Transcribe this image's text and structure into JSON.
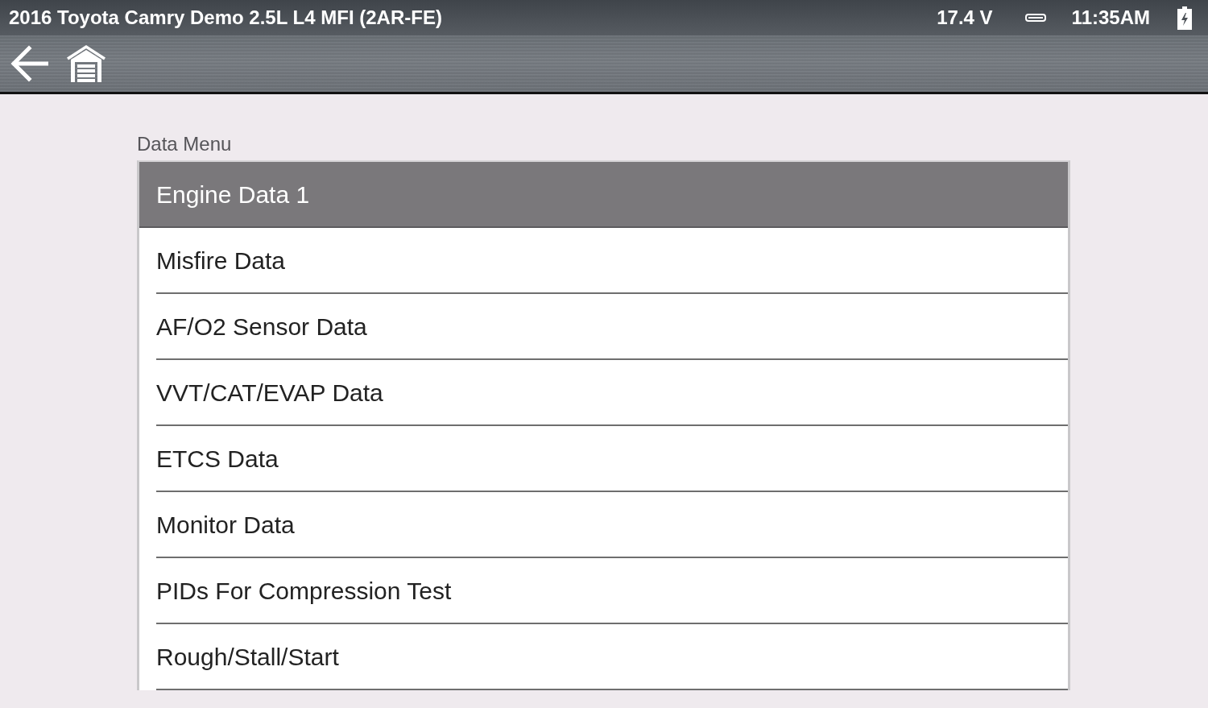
{
  "status_bar": {
    "title": "2016 Toyota Camry Demo 2.5L L4 MFI (2AR-FE)",
    "voltage": "17.4 V",
    "time": "11:35AM"
  },
  "data_menu": {
    "title": "Data Menu",
    "items": [
      {
        "label": "Engine Data 1",
        "selected": true
      },
      {
        "label": "Misfire Data",
        "selected": false
      },
      {
        "label": "AF/O2 Sensor Data",
        "selected": false
      },
      {
        "label": "VVT/CAT/EVAP Data",
        "selected": false
      },
      {
        "label": "ETCS Data",
        "selected": false
      },
      {
        "label": "Monitor Data",
        "selected": false
      },
      {
        "label": "PIDs For Compression Test",
        "selected": false
      },
      {
        "label": "Rough/Stall/Start",
        "selected": false
      }
    ]
  }
}
